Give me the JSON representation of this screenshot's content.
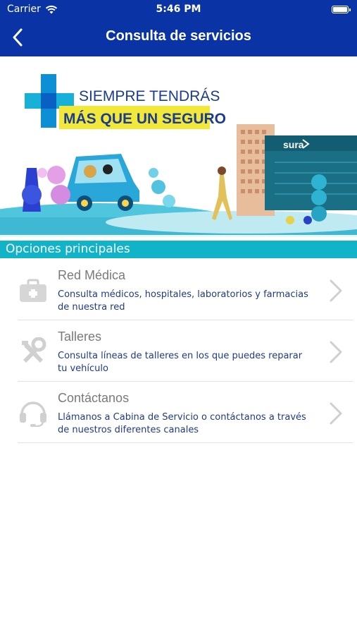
{
  "status": {
    "carrier": "Carrier",
    "time": "5:46 PM"
  },
  "nav": {
    "title": "Consulta de servicios",
    "back_icon": "chevron-left-icon"
  },
  "banner": {
    "line1": "SIEMPRE TENDRÁS",
    "line2": "MÁS QUE UN SEGURO",
    "brand": "sura"
  },
  "section": {
    "title": "Opciones principales"
  },
  "options": [
    {
      "title": "Red Médica",
      "desc": "Consulta médicos, hospitales, laboratorios y farmacias de nuestra red",
      "icon": "briefcase-icon"
    },
    {
      "title": "Talleres",
      "desc": "Consulta líneas de talleres en los que puedes reparar tu vehículo",
      "icon": "tools-icon"
    },
    {
      "title": "Contáctanos",
      "desc": "Llámanos a Cabina de Servicio o contáctanos a través de nuestros diferentes canales",
      "icon": "headset-icon"
    }
  ],
  "colors": {
    "header": "#0a33a6",
    "accent": "#10b3c8",
    "desc_text": "#1f3a8a"
  }
}
